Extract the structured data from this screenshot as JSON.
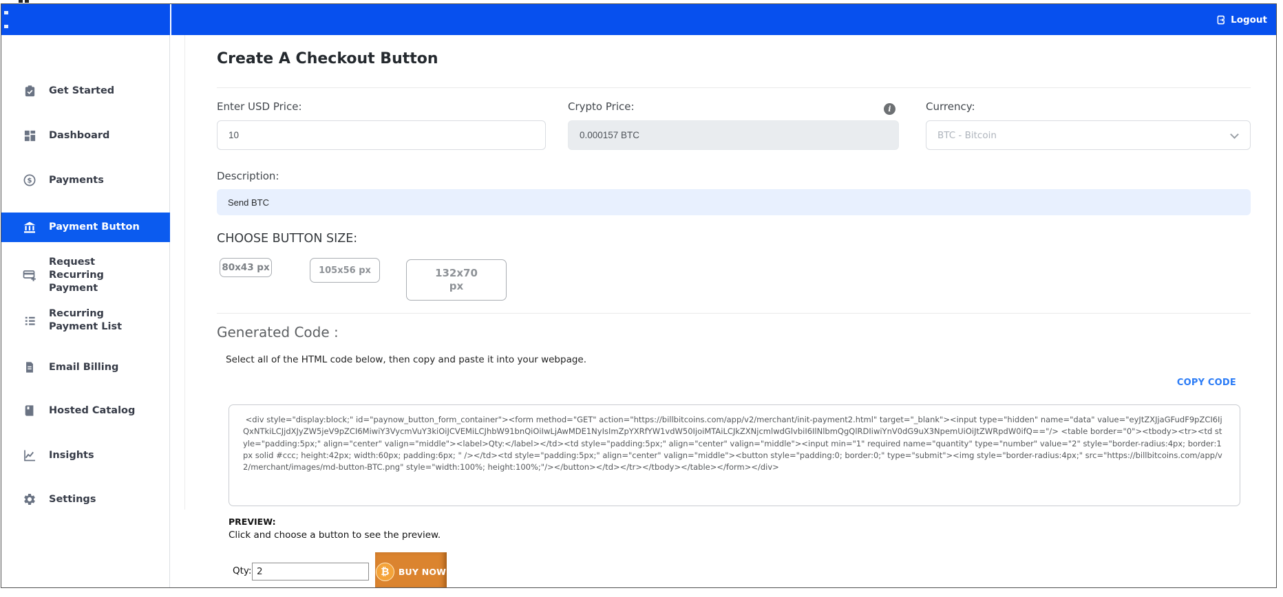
{
  "topbar": {
    "logout_label": "Logout",
    "logout_icon": "logout-icon",
    "background_color": "#0750ee"
  },
  "sidebar": {
    "items": [
      {
        "label": "Get Started",
        "icon": "clipboard-check-icon",
        "active": false
      },
      {
        "label": "Dashboard",
        "icon": "dashboard-grid-icon",
        "active": false
      },
      {
        "label": "Payments",
        "icon": "dollar-circle-icon",
        "active": false
      },
      {
        "label": "Payment Button",
        "icon": "bank-icon",
        "active": true
      },
      {
        "label": "Request Recurring Payment",
        "icon": "card-plus-icon",
        "active": false
      },
      {
        "label": "Recurring Payment List",
        "icon": "list-icon",
        "active": false
      },
      {
        "label": "Email Billing",
        "icon": "document-icon",
        "active": false
      },
      {
        "label": "Hosted Catalog",
        "icon": "book-icon",
        "active": false
      },
      {
        "label": "Insights",
        "icon": "chart-line-icon",
        "active": false
      },
      {
        "label": "Settings",
        "icon": "gear-icon",
        "active": false
      }
    ],
    "active_color": "#0b5bef"
  },
  "main": {
    "title": "Create A Checkout Button",
    "fields": {
      "usd_price": {
        "label": "Enter USD Price:",
        "value": "10"
      },
      "crypto_price": {
        "label": "Crypto Price:",
        "value": "0.000157 BTC",
        "info_icon": "info-icon",
        "disabled": true
      },
      "currency": {
        "label": "Currency:",
        "value": "BTC - Bitcoin",
        "chevron_icon": "chevron-down-icon"
      },
      "description": {
        "label": "Description:",
        "value": "Send BTC"
      }
    },
    "button_size": {
      "label": "CHOOSE BUTTON SIZE:",
      "options": [
        "80x43 px",
        "105x56 px",
        "132x70 px"
      ]
    },
    "generated_code": {
      "title": "Generated Code :",
      "instruction": "Select all of the HTML code below, then copy and paste it into your webpage.",
      "copy_label": "COPY CODE",
      "copy_color": "#2a7bf6",
      "code": " <div style=\"display:block;\" id=\"paynow_button_form_container\"><form method=\"GET\" action=\"https://billbitcoins.com/app/v2/merchant/init-payment2.html\" target=\"_blank\"><input type=\"hidden\" name=\"data\" value=\"eyJtZXJjaGFudF9pZCI6IjQxNTkiLCJjdXJyZW5jeV9pZCI6MiwiY3VycmVuY3kiOiJCVEMiLCJhbW91bnQiOiIwLjAwMDE1NyIsImZpYXRfYW1vdW50IjoiMTAiLCJkZXNjcmlwdGlvbiI6IlNlbmQgQlRDIiwiYnV0dG9uX3NpemUiOiJtZWRpdW0ifQ==\"/> <table border=\"0\"><tbody><tr><td style=\"padding:5px;\" align=\"center\" valign=\"middle\"><label>Qty:</label></td><td style=\"padding:5px;\" align=\"center\" valign=\"middle\"><input min=\"1\" required name=\"quantity\" type=\"number\" value=\"2\" style=\"border-radius:4px; border:1px solid #ccc; height:42px; width:60px; padding:6px; \" /></td><td style=\"padding:5px;\" align=\"center\" valign=\"middle\"><button style=\"padding:0; border:0;\" type=\"submit\"><img style=\"border-radius:4px;\" src=\"https://billbitcoins.com/app/v2/merchant/images/md-button-BTC.png\" style=\"width:100%; height:100%;\"/></button></td></tr></tbody></table></form></div>"
    },
    "preview": {
      "title": "PREVIEW:",
      "instruction": "Click and choose a button to see the preview.",
      "qty_label": "Qty:",
      "qty_value": "2",
      "buy_button_label": "BUY NOW",
      "bitcoin_symbol": "₿",
      "buy_button_color": "#db842f"
    }
  }
}
